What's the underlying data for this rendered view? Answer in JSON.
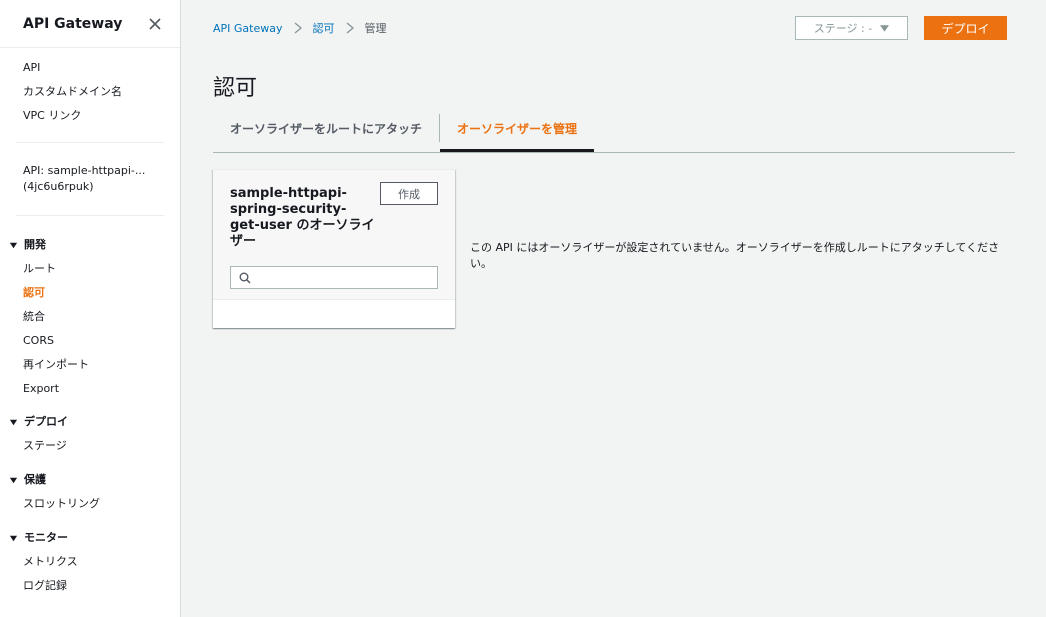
{
  "sidebar": {
    "title": "API Gateway",
    "top_items": [
      {
        "label": "API"
      },
      {
        "label": "カスタムドメイン名"
      },
      {
        "label": "VPC リンク"
      }
    ],
    "api_label_line1": "API: sample-httpapi-...",
    "api_label_line2": "(4jc6u6rpuk)",
    "sections": [
      {
        "title": "開発",
        "items": [
          {
            "label": "ルート"
          },
          {
            "label": "認可",
            "active": true
          },
          {
            "label": "統合"
          },
          {
            "label": "CORS"
          },
          {
            "label": "再インポート"
          },
          {
            "label": "Export"
          }
        ]
      },
      {
        "title": "デプロイ",
        "items": [
          {
            "label": "ステージ"
          }
        ]
      },
      {
        "title": "保護",
        "items": [
          {
            "label": "スロットリング"
          }
        ]
      },
      {
        "title": "モニター",
        "items": [
          {
            "label": "メトリクス"
          },
          {
            "label": "ログ記録"
          }
        ]
      }
    ]
  },
  "breadcrumb": {
    "items": [
      {
        "label": "API Gateway"
      },
      {
        "label": "認可"
      },
      {
        "label": "管理"
      }
    ]
  },
  "header": {
    "stage_select_label": "ステージ : -",
    "deploy_label": "デプロイ"
  },
  "page": {
    "title": "認可",
    "tabs": [
      {
        "label": "オーソライザーをルートにアタッチ"
      },
      {
        "label": "オーソライザーを管理",
        "active": true
      }
    ]
  },
  "card": {
    "title": "sample-httpapi-spring-security-get-user のオーソライザー",
    "create_label": "作成",
    "search_placeholder": "",
    "search_value": ""
  },
  "empty_message": "この API にはオーソライザーが設定されていません。オーソライザーを作成しルートにアタッチしてください。",
  "colors": {
    "accent": "#ec7211",
    "link": "#0073bb",
    "background": "#f2f3f3"
  }
}
